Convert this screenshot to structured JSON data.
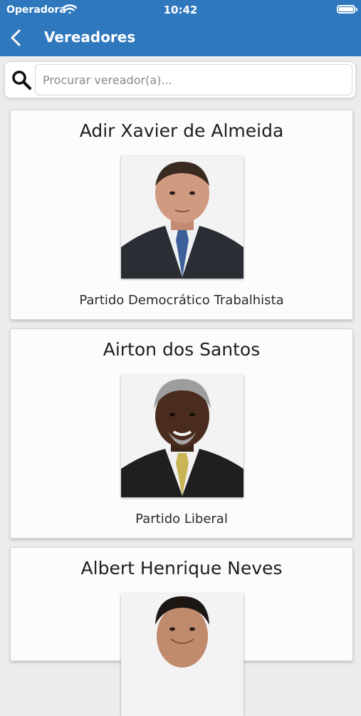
{
  "status_bar": {
    "carrier": "Operadora",
    "time": "10:42",
    "wifi_icon": "wifi-icon",
    "battery_icon": "battery-icon"
  },
  "nav": {
    "title": "Vereadores",
    "back_icon": "chevron-left-icon"
  },
  "search": {
    "placeholder": "Procurar vereador(a)...",
    "value": "",
    "icon": "search-icon"
  },
  "colors": {
    "header": "#2f78bd",
    "background": "#ececec",
    "card": "#fcfcfc"
  },
  "councilors": [
    {
      "name": "Adir Xavier de Almeida",
      "party": "Partido Democrático Trabalhista",
      "tie_color": "#3d5f9a"
    },
    {
      "name": "Airton dos Santos",
      "party": "Partido Liberal",
      "tie_color": "#c9b556"
    },
    {
      "name": "Albert Henrique Neves",
      "party": "",
      "tie_color": ""
    }
  ]
}
